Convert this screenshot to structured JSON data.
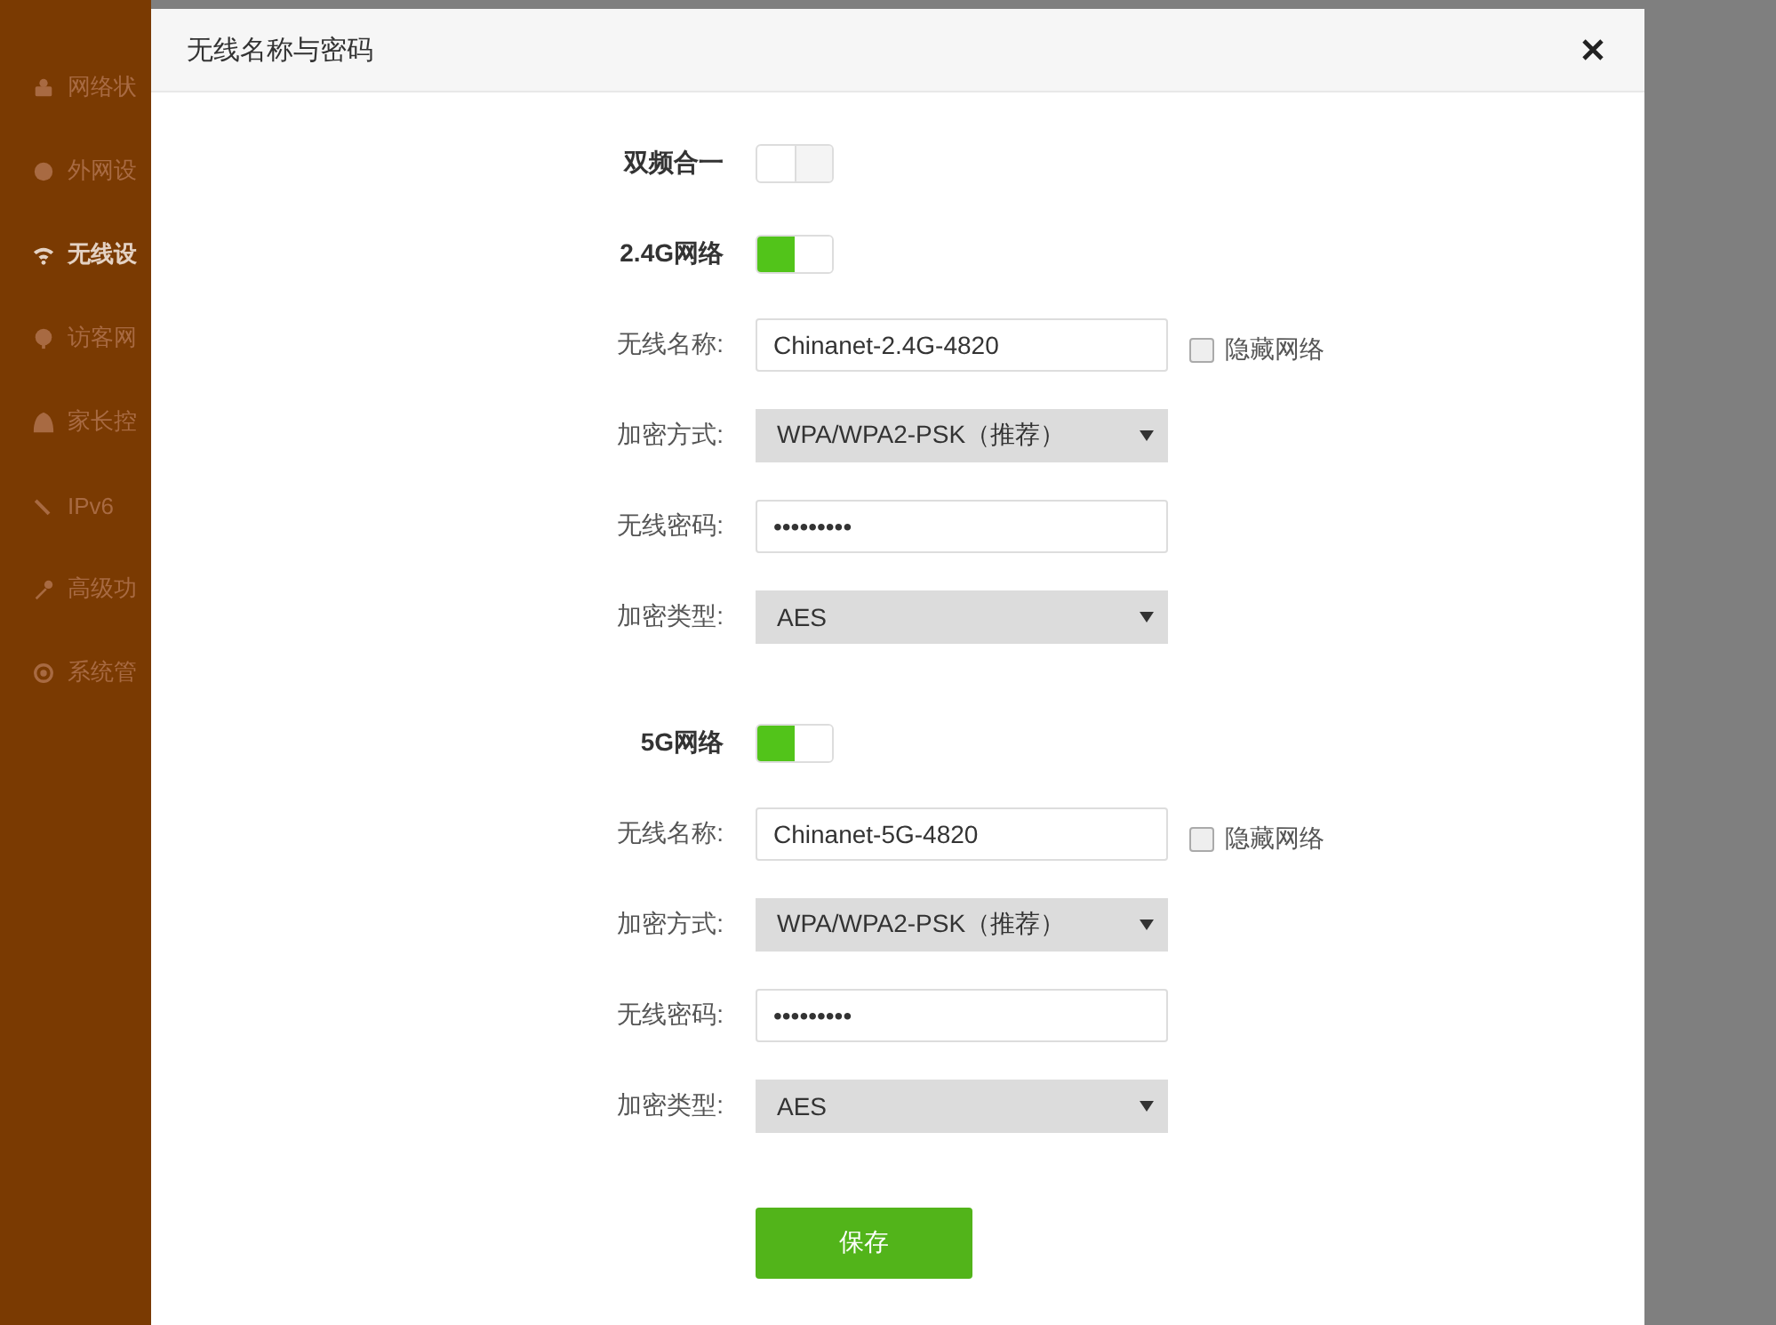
{
  "sidebar": {
    "items": [
      {
        "label": "网络状",
        "selected": false
      },
      {
        "label": "外网设",
        "selected": false
      },
      {
        "label": "无线设",
        "selected": true
      },
      {
        "label": "访客网",
        "selected": false
      },
      {
        "label": "家长控",
        "selected": false
      },
      {
        "label": "IPv6",
        "selected": false
      },
      {
        "label": "高级功",
        "selected": false
      },
      {
        "label": "系统管",
        "selected": false
      }
    ]
  },
  "dialog": {
    "title": "无线名称与密码",
    "dual_band": {
      "label": "双频合一",
      "on": false
    },
    "bands": [
      {
        "label": "2.4G网络",
        "on": true,
        "fields": [
          {
            "kind": "text",
            "label": "无线名称:",
            "value": "Chinanet-2.4G-4820",
            "checkbox": {
              "label": "隐藏网络",
              "checked": false
            }
          },
          {
            "kind": "select",
            "label": "加密方式:",
            "value": "WPA/WPA2-PSK（推荐）"
          },
          {
            "kind": "text",
            "label": "无线密码:",
            "value": "•••••••••"
          },
          {
            "kind": "select",
            "label": "加密类型:",
            "value": "AES"
          }
        ]
      },
      {
        "label": "5G网络",
        "on": true,
        "fields": [
          {
            "kind": "text",
            "label": "无线名称:",
            "value": "Chinanet-5G-4820",
            "checkbox": {
              "label": "隐藏网络",
              "checked": false
            }
          },
          {
            "kind": "select",
            "label": "加密方式:",
            "value": "WPA/WPA2-PSK（推荐）"
          },
          {
            "kind": "text",
            "label": "无线密码:",
            "value": "•••••••••"
          },
          {
            "kind": "select",
            "label": "加密类型:",
            "value": "AES"
          }
        ]
      }
    ],
    "save_button": "保存"
  }
}
